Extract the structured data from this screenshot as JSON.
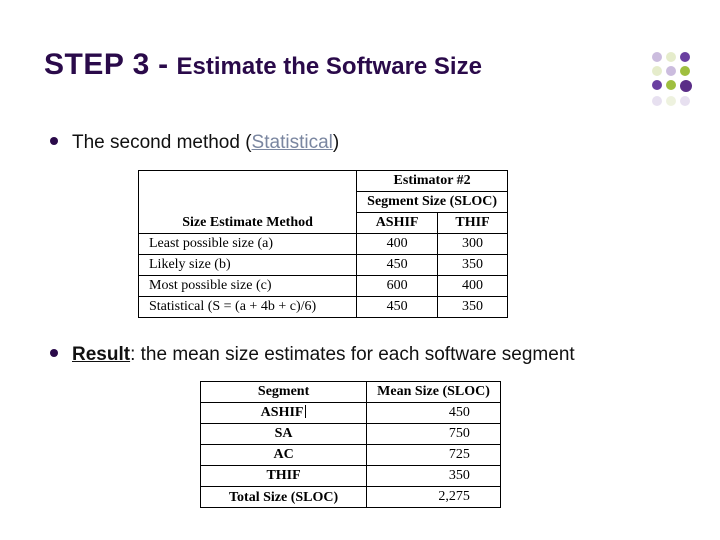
{
  "title": {
    "step": "STEP 3",
    "sep": " - ",
    "rest": "Estimate the Software Size"
  },
  "bullet1": {
    "pre": "The second method (",
    "stat": "Statistical",
    "post": ")"
  },
  "table1": {
    "h_method": "Size Estimate Method",
    "h_est": "Estimator #2",
    "h_segsize": "Segment Size (SLOC)",
    "h_ashif": "ASHIF",
    "h_thif": "THIF",
    "rows": [
      {
        "m": "Least possible size (a)",
        "a": "400",
        "t": "300"
      },
      {
        "m": "Likely size (b)",
        "a": "450",
        "t": "350"
      },
      {
        "m": "Most possible size (c)",
        "a": "600",
        "t": "400"
      },
      {
        "m": "Statistical (S = (a + 4b + c)/6)",
        "a": "450",
        "t": "350"
      }
    ]
  },
  "bullet2": {
    "res": "Result",
    "rest": ": the mean size estimates for each software segment"
  },
  "table2": {
    "h_seg": "Segment",
    "h_mean": "Mean Size (SLOC)",
    "rows": [
      {
        "s": "ASHIF",
        "v": "450"
      },
      {
        "s": "SA",
        "v": "750"
      },
      {
        "s": "AC",
        "v": "725"
      },
      {
        "s": "THIF",
        "v": "350"
      },
      {
        "s": "Total Size (SLOC)",
        "v": "2,275"
      }
    ]
  },
  "chart_data": [
    {
      "type": "table",
      "title": "Estimator #2 — Segment Size (SLOC)",
      "columns": [
        "Size Estimate Method",
        "ASHIF",
        "THIF"
      ],
      "rows": [
        [
          "Least possible size (a)",
          400,
          300
        ],
        [
          "Likely size (b)",
          450,
          350
        ],
        [
          "Most possible size (c)",
          600,
          400
        ],
        [
          "Statistical (S = (a + 4b + c)/6)",
          450,
          350
        ]
      ]
    },
    {
      "type": "table",
      "title": "Mean Size (SLOC) per Segment",
      "columns": [
        "Segment",
        "Mean Size (SLOC)"
      ],
      "rows": [
        [
          "ASHIF",
          450
        ],
        [
          "SA",
          750
        ],
        [
          "AC",
          725
        ],
        [
          "THIF",
          350
        ],
        [
          "Total Size (SLOC)",
          2275
        ]
      ]
    }
  ]
}
